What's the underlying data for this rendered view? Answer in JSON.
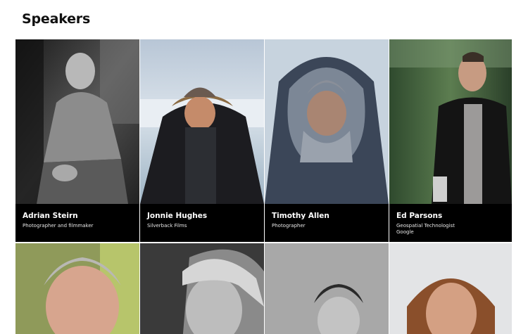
{
  "page": {
    "title": "Speakers"
  },
  "speakers": [
    {
      "name": "Adrian Steirn",
      "role": "Photographer and filmmaker",
      "org": ""
    },
    {
      "name": "Jonnie Hughes",
      "role": "Silverback Films",
      "org": ""
    },
    {
      "name": "Timothy Allen",
      "role": "Photographer",
      "org": ""
    },
    {
      "name": "Ed Parsons",
      "role": "Geospatial Technologist",
      "org": "Google"
    }
  ]
}
